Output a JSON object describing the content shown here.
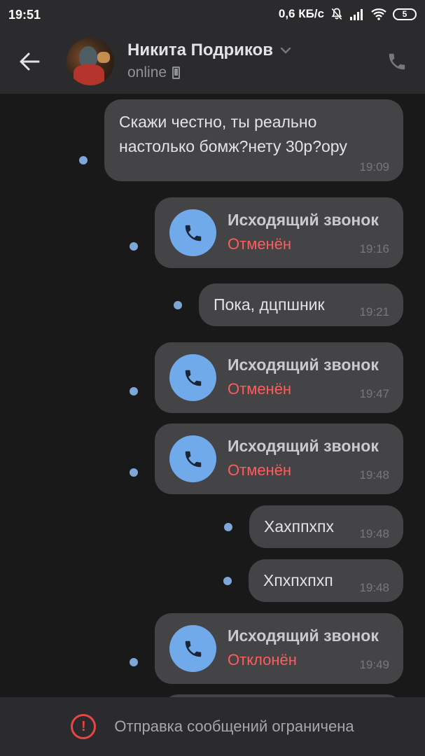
{
  "status_bar": {
    "time": "19:51",
    "net_speed": "0,6 КБ/с",
    "battery": "5"
  },
  "header": {
    "contact_name": "Никита Подриков",
    "status": "online"
  },
  "messages": [
    {
      "type": "text",
      "lines": [
        "Скажи честно, ты реально",
        "настолько бомж?нету 30р?ору"
      ],
      "time": "19:09"
    },
    {
      "type": "call",
      "title": "Исходящий звонок",
      "state": "Отменён",
      "time": "19:16"
    },
    {
      "type": "text",
      "lines": [
        "Пока, дцпшник"
      ],
      "time": "19:21"
    },
    {
      "type": "call",
      "title": "Исходящий звонок",
      "state": "Отменён",
      "time": "19:47"
    },
    {
      "type": "call",
      "title": "Исходящий звонок",
      "state": "Отменён",
      "time": "19:48"
    },
    {
      "type": "text",
      "lines": [
        "Хахппхпх"
      ],
      "time": "19:48"
    },
    {
      "type": "text",
      "lines": [
        "Хпхпхпхп"
      ],
      "time": "19:48"
    },
    {
      "type": "call",
      "title": "Исходящий звонок",
      "state": "Отклонён",
      "time": "19:49"
    }
  ],
  "bottom_bar": {
    "text": "Отправка сообщений ограничена"
  },
  "colors": {
    "background": "#19191a",
    "bubble": "#444446",
    "unread_dot": "#7ea6d8",
    "call_icon": "#71aaeb",
    "cancelled": "#ff5c5c"
  }
}
